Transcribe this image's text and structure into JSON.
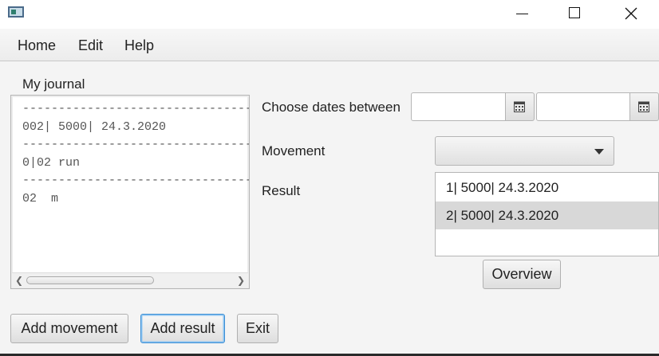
{
  "menu": {
    "home": "Home",
    "edit": "Edit",
    "help": "Help"
  },
  "journal": {
    "title": "My journal",
    "lines": [
      "-------------------------------------",
      "002| 5000| 24.3.2020",
      "-------------------------------------",
      "0|02 run",
      "-------------------------------------",
      "02  m"
    ]
  },
  "filters": {
    "dates_label": "Choose dates between",
    "date_from": "",
    "date_to": "",
    "movement_label": "Movement",
    "movement_selected": "",
    "result_label": "Result"
  },
  "results": [
    "1| 5000| 24.3.2020",
    "2| 5000| 24.3.2020"
  ],
  "buttons": {
    "overview": "Overview",
    "add_movement": "Add movement",
    "add_result": "Add result",
    "exit": "Exit"
  },
  "icons": {
    "app": "app-icon",
    "minimize": "minimize-icon",
    "maximize": "maximize-icon",
    "close": "close-icon",
    "calendar": "calendar-icon",
    "dropdown": "chevron-down-icon"
  }
}
